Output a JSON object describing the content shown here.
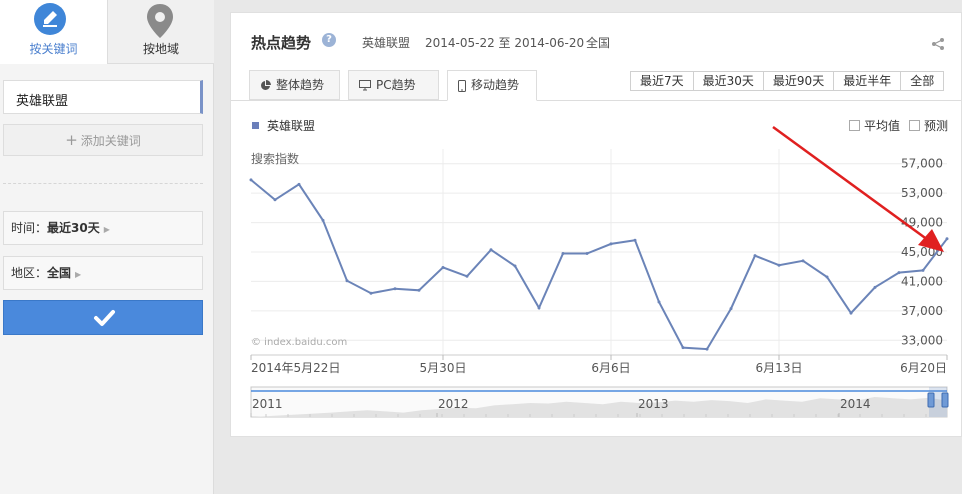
{
  "sidebar": {
    "tab_keyword": "按关键词",
    "tab_region": "按地域",
    "keyword": "英雄联盟",
    "add_keyword": "添加关键词",
    "time_label": "时间：",
    "time_value": "最近30天",
    "region_label": "地区：",
    "region_value": "全国",
    "accent": "#4a89dc"
  },
  "panel": {
    "title": "热点趋势",
    "keyword": "英雄联盟",
    "date_range": "2014-05-22 至 2014-06-20",
    "region": "全国",
    "tabs": [
      {
        "label": "整体趋势",
        "icon": "pie-chart-icon"
      },
      {
        "label": "PC趋势",
        "icon": "monitor-icon"
      },
      {
        "label": "移动趋势",
        "icon": "phone-icon",
        "active": true
      }
    ],
    "ranges": [
      "最近7天",
      "最近30天",
      "最近90天",
      "最近半年",
      "全部"
    ],
    "legend": "英雄联盟",
    "avg_label": "平均值",
    "forecast_label": "预测"
  },
  "chart_data": {
    "type": "line",
    "ylabel": "搜索指数",
    "watermark": "© index.baidu.com",
    "ylim": [
      31000,
      59000
    ],
    "yticks": [
      "57,000",
      "53,000",
      "49,000",
      "45,000",
      "41,000",
      "37,000",
      "33,000"
    ],
    "x_labels": [
      "2014年5月22日",
      "5月30日",
      "6月6日",
      "6月13日",
      "6月20日"
    ],
    "series": [
      {
        "name": "英雄联盟",
        "color": "#6b84b8",
        "values": [
          54800,
          52100,
          54200,
          49300,
          41100,
          39400,
          40000,
          39800,
          42900,
          41700,
          45300,
          43100,
          37400,
          44800,
          44800,
          46100,
          46600,
          38200,
          32000,
          31800,
          37300,
          44500,
          43200,
          43800,
          41600,
          36700,
          40200,
          42200,
          42500,
          46800
        ]
      }
    ],
    "navigator_years": [
      "2011",
      "2012",
      "2013",
      "2014"
    ]
  },
  "annotation": {
    "arrow_color": "#e02020"
  }
}
